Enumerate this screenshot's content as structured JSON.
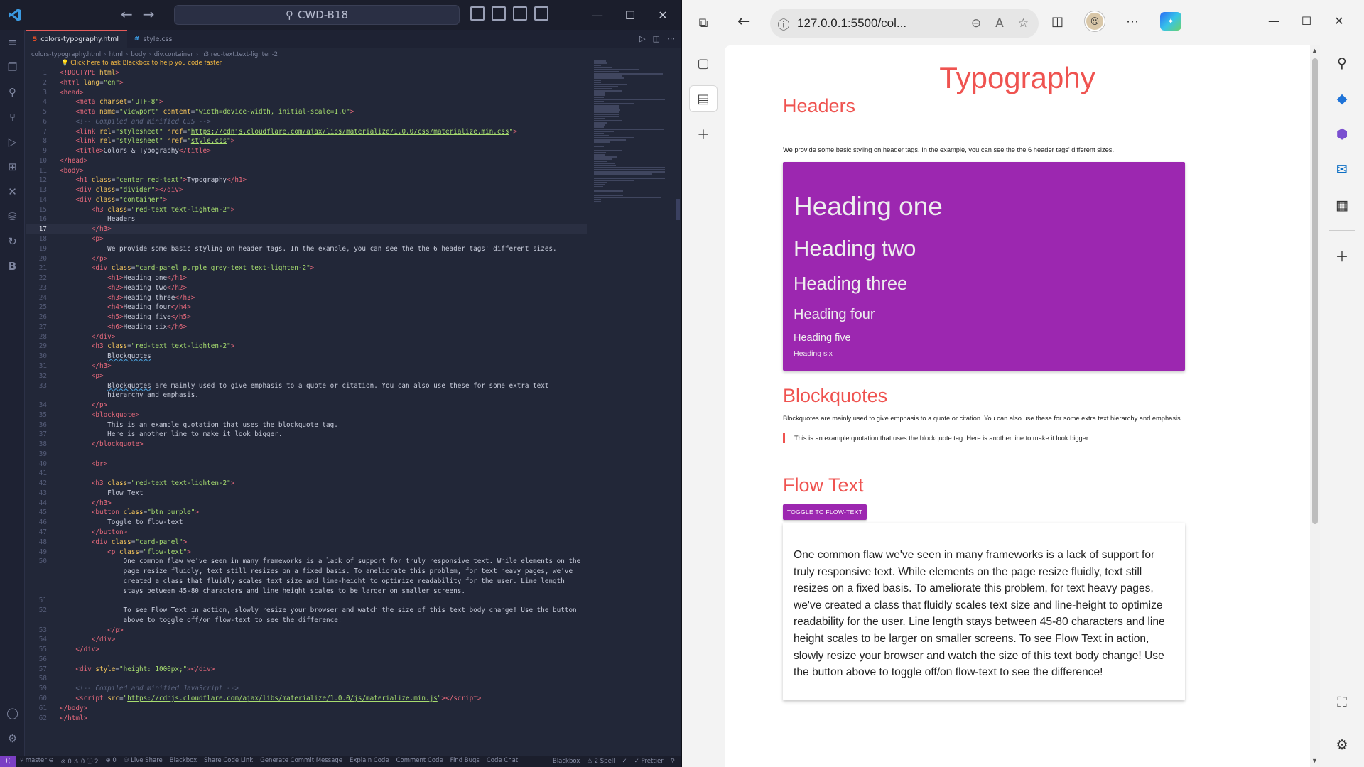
{
  "vscode": {
    "search": "CWD-B18",
    "tabs": [
      {
        "label": "colors-typography.html",
        "icon": "html-file-icon",
        "active": true
      },
      {
        "label": "style.css",
        "icon": "css-file-icon",
        "active": false
      }
    ],
    "breadcrumb": [
      "colors-typography.html",
      "html",
      "body",
      "div.container",
      "h3.red-text.text-lighten-2"
    ],
    "hint": "💡 Click here to ask Blackbox to help you code faster",
    "current_line": 17,
    "lines": [
      {
        "n": 1,
        "h": "<span class=\"tag\">&lt;!DOCTYPE</span> <span class=\"atr\">html</span><span class=\"tag\">&gt;</span>"
      },
      {
        "n": 2,
        "h": "<span class=\"tag\">&lt;html</span> <span class=\"atr\">lang</span>=<span class=\"str\">\"en\"</span><span class=\"tag\">&gt;</span>"
      },
      {
        "n": 3,
        "h": "<span class=\"tag\">&lt;head&gt;</span>"
      },
      {
        "n": 4,
        "h": "    <span class=\"tag\">&lt;meta</span> <span class=\"atr\">charset</span>=<span class=\"str\">\"UTF-8\"</span><span class=\"tag\">&gt;</span>"
      },
      {
        "n": 5,
        "h": "    <span class=\"tag\">&lt;meta</span> <span class=\"atr\">name</span>=<span class=\"str\">\"viewport\"</span> <span class=\"atr\">content</span>=<span class=\"str\">\"width=device-width, initial-scale=1.0\"</span><span class=\"tag\">&gt;</span>"
      },
      {
        "n": 6,
        "h": "    <span class=\"cm\">&lt;!-- Compiled and minified CSS --&gt;</span>"
      },
      {
        "n": 7,
        "h": "    <span class=\"tag\">&lt;link</span> <span class=\"atr\">rel</span>=<span class=\"str\">\"stylesheet\"</span> <span class=\"atr\">href</span>=<span class=\"str\">\"<span class=\"lnk\">https://cdnjs.cloudflare.com/ajax/libs/materialize/1.0.0/css/materialize.min.css</span>\"</span><span class=\"tag\">&gt;</span>"
      },
      {
        "n": 8,
        "h": "    <span class=\"tag\">&lt;link</span> <span class=\"atr\">rel</span>=<span class=\"str\">\"stylesheet\"</span> <span class=\"atr\">href</span>=<span class=\"str\">\"<span class=\"lnk\">style.css</span>\"</span><span class=\"tag\">&gt;</span>"
      },
      {
        "n": 9,
        "h": "    <span class=\"tag\">&lt;title&gt;</span>Colors &amp; Typography<span class=\"tag\">&lt;/title&gt;</span>"
      },
      {
        "n": 10,
        "h": "<span class=\"tag\">&lt;/head&gt;</span>"
      },
      {
        "n": 11,
        "h": "<span class=\"tag\">&lt;body&gt;</span>"
      },
      {
        "n": 12,
        "h": "    <span class=\"tag\">&lt;h1</span> <span class=\"atr\">class</span>=<span class=\"str\">\"center red-text\"</span><span class=\"tag\">&gt;</span>Typography<span class=\"tag\">&lt;/h1&gt;</span>"
      },
      {
        "n": 13,
        "h": "    <span class=\"tag\">&lt;div</span> <span class=\"atr\">class</span>=<span class=\"str\">\"divider\"</span><span class=\"tag\">&gt;&lt;/div&gt;</span>"
      },
      {
        "n": 14,
        "h": "    <span class=\"tag\">&lt;div</span> <span class=\"atr\">class</span>=<span class=\"str\">\"container\"</span><span class=\"tag\">&gt;</span>"
      },
      {
        "n": 15,
        "h": "        <span class=\"tag\">&lt;h3</span> <span class=\"atr\">class</span>=<span class=\"str\">\"red-text text-lighten-2\"</span><span class=\"tag\">&gt;</span>"
      },
      {
        "n": 16,
        "h": "            Headers"
      },
      {
        "n": 17,
        "h": "        <span class=\"tag\">&lt;/h3&gt;</span>"
      },
      {
        "n": 18,
        "h": "        <span class=\"tag\">&lt;p&gt;</span>"
      },
      {
        "n": 19,
        "h": "            We provide some basic styling on header tags. In the example, you can see the the 6 header tags' different sizes."
      },
      {
        "n": 20,
        "h": "        <span class=\"tag\">&lt;/p&gt;</span>"
      },
      {
        "n": 21,
        "h": "        <span class=\"tag\">&lt;div</span> <span class=\"atr\">class</span>=<span class=\"str\">\"card-panel purple grey-text text-lighten-2\"</span><span class=\"tag\">&gt;</span>"
      },
      {
        "n": 22,
        "h": "            <span class=\"tag\">&lt;h1&gt;</span>Heading one<span class=\"tag\">&lt;/h1&gt;</span>"
      },
      {
        "n": 23,
        "h": "            <span class=\"tag\">&lt;h2&gt;</span>Heading two<span class=\"tag\">&lt;/h2&gt;</span>"
      },
      {
        "n": 24,
        "h": "            <span class=\"tag\">&lt;h3&gt;</span>Heading three<span class=\"tag\">&lt;/h3&gt;</span>"
      },
      {
        "n": 25,
        "h": "            <span class=\"tag\">&lt;h4&gt;</span>Heading four<span class=\"tag\">&lt;/h4&gt;</span>"
      },
      {
        "n": 26,
        "h": "            <span class=\"tag\">&lt;h5&gt;</span>Heading five<span class=\"tag\">&lt;/h5&gt;</span>"
      },
      {
        "n": 27,
        "h": "            <span class=\"tag\">&lt;h6&gt;</span>Heading six<span class=\"tag\">&lt;/h6&gt;</span>"
      },
      {
        "n": 28,
        "h": "        <span class=\"tag\">&lt;/div&gt;</span>"
      },
      {
        "n": 29,
        "h": "        <span class=\"tag\">&lt;h3</span> <span class=\"atr\">class</span>=<span class=\"str\">\"red-text text-lighten-2\"</span><span class=\"tag\">&gt;</span>"
      },
      {
        "n": 30,
        "h": "            <span class=\"und\">Blockquotes</span>"
      },
      {
        "n": 31,
        "h": "        <span class=\"tag\">&lt;/h3&gt;</span>"
      },
      {
        "n": 32,
        "h": "        <span class=\"tag\">&lt;p&gt;</span>"
      },
      {
        "n": 33,
        "h": "            <span class=\"und\">Blockquotes</span> are mainly used to give emphasis to a quote or citation. You can also use these for some extra text"
      },
      {
        "n": "",
        "h": "            hierarchy and emphasis."
      },
      {
        "n": 34,
        "h": "        <span class=\"tag\">&lt;/p&gt;</span>"
      },
      {
        "n": 35,
        "h": "        <span class=\"tag\">&lt;blockquote&gt;</span>"
      },
      {
        "n": 36,
        "h": "            This is an example quotation that uses the blockquote tag."
      },
      {
        "n": 37,
        "h": "            Here is another line to make it look bigger."
      },
      {
        "n": 38,
        "h": "        <span class=\"tag\">&lt;/blockquote&gt;</span>"
      },
      {
        "n": 39,
        "h": ""
      },
      {
        "n": 40,
        "h": "        <span class=\"tag\">&lt;br&gt;</span>"
      },
      {
        "n": 41,
        "h": ""
      },
      {
        "n": 42,
        "h": "        <span class=\"tag\">&lt;h3</span> <span class=\"atr\">class</span>=<span class=\"str\">\"red-text text-lighten-2\"</span><span class=\"tag\">&gt;</span>"
      },
      {
        "n": 43,
        "h": "            Flow Text"
      },
      {
        "n": 44,
        "h": "        <span class=\"tag\">&lt;/h3&gt;</span>"
      },
      {
        "n": 45,
        "h": "        <span class=\"tag\">&lt;button</span> <span class=\"atr\">class</span>=<span class=\"str\">\"btn purple\"</span><span class=\"tag\">&gt;</span>"
      },
      {
        "n": 46,
        "h": "            Toggle to flow-text"
      },
      {
        "n": 47,
        "h": "        <span class=\"tag\">&lt;/button&gt;</span>"
      },
      {
        "n": 48,
        "h": "        <span class=\"tag\">&lt;div</span> <span class=\"atr\">class</span>=<span class=\"str\">\"card-panel\"</span><span class=\"tag\">&gt;</span>"
      },
      {
        "n": 49,
        "h": "            <span class=\"tag\">&lt;p</span> <span class=\"atr\">class</span>=<span class=\"str\">\"flow-text\"</span><span class=\"tag\">&gt;</span>"
      },
      {
        "n": 50,
        "h": "                One common flaw we've seen in many frameworks is a lack of support for truly responsive text. While elements on the"
      },
      {
        "n": "",
        "h": "                page resize fluidly, text still resizes on a fixed basis. To ameliorate this problem, for text heavy pages, we've"
      },
      {
        "n": "",
        "h": "                created a class that fluidly scales text size and line-height to optimize readability for the user. Line length"
      },
      {
        "n": "",
        "h": "                stays between 45-80 characters and line height scales to be larger on smaller screens."
      },
      {
        "n": 51,
        "h": ""
      },
      {
        "n": 52,
        "h": "                To see Flow Text in action, slowly resize your browser and watch the size of this text body change! Use the button"
      },
      {
        "n": "",
        "h": "                above to toggle off/on flow-text to see the difference!"
      },
      {
        "n": 53,
        "h": "            <span class=\"tag\">&lt;/p&gt;</span>"
      },
      {
        "n": 54,
        "h": "        <span class=\"tag\">&lt;/div&gt;</span>"
      },
      {
        "n": 55,
        "h": "    <span class=\"tag\">&lt;/div&gt;</span>"
      },
      {
        "n": 56,
        "h": ""
      },
      {
        "n": 57,
        "h": "    <span class=\"tag\">&lt;div</span> <span class=\"atr\">style</span>=<span class=\"str\">\"height: 1000px;\"</span><span class=\"tag\">&gt;&lt;/div&gt;</span>"
      },
      {
        "n": 58,
        "h": ""
      },
      {
        "n": 59,
        "h": "    <span class=\"cm\">&lt;!-- Compiled and minified JavaScript --&gt;</span>"
      },
      {
        "n": 60,
        "h": "    <span class=\"tag\">&lt;script</span> <span class=\"atr\">src</span>=<span class=\"str\">\"<span class=\"lnk\">https://cdnjs.cloudflare.com/ajax/libs/materialize/1.0.0/js/materialize.min.js</span>\"</span><span class=\"tag\">&gt;&lt;/script&gt;</span>"
      },
      {
        "n": 61,
        "h": "<span class=\"tag\">&lt;/body&gt;</span>"
      },
      {
        "n": 62,
        "h": "<span class=\"tag\">&lt;/html&gt;</span>"
      }
    ],
    "status_left": [
      "⑂ master ⊖",
      "⊗ 0 ⚠ 0 ⓘ 2",
      "⊕ 0",
      "⚇ Live Share",
      "Blackbox",
      "Share Code Link",
      "Generate Commit Message",
      "Explain Code",
      "Comment Code",
      "Find Bugs",
      "Code Chat"
    ],
    "status_right": [
      "Blackbox",
      "⚠ 2 Spell",
      "✓",
      "✓ Prettier",
      "⚲"
    ]
  },
  "browser": {
    "url": "127.0.0.1:5500/col...",
    "page": {
      "title": "Typography",
      "headers_title": "Headers",
      "headers_text": "We provide some basic styling on header tags. In the example, you can see the the 6 header tags' different sizes.",
      "headings": [
        "Heading one",
        "Heading two",
        "Heading three",
        "Heading four",
        "Heading five",
        "Heading six"
      ],
      "blockquotes_title": "Blockquotes",
      "blockquotes_text": "Blockquotes are mainly used to give emphasis to a quote or citation. You can also use these for some extra text hierarchy and emphasis.",
      "quote": "This is an example quotation that uses the blockquote tag. Here is another line to make it look bigger.",
      "flow_title": "Flow Text",
      "button": "TOGGLE TO FLOW-TEXT",
      "flow_text": "One common flaw we've seen in many frameworks is a lack of support for truly responsive text. While elements on the page resize fluidly, text still resizes on a fixed basis. To ameliorate this problem, for text heavy pages, we've created a class that fluidly scales text size and line-height to optimize readability for the user. Line length stays between 45-80 characters and line height scales to be larger on smaller screens. To see Flow Text in action, slowly resize your browser and watch the size of this text body change! Use the button above to toggle off/on flow-text to see the difference!"
    }
  },
  "colors": {
    "accent_red": "#ef5350",
    "purple": "#9c27b0",
    "vscode_bg": "#222738"
  }
}
